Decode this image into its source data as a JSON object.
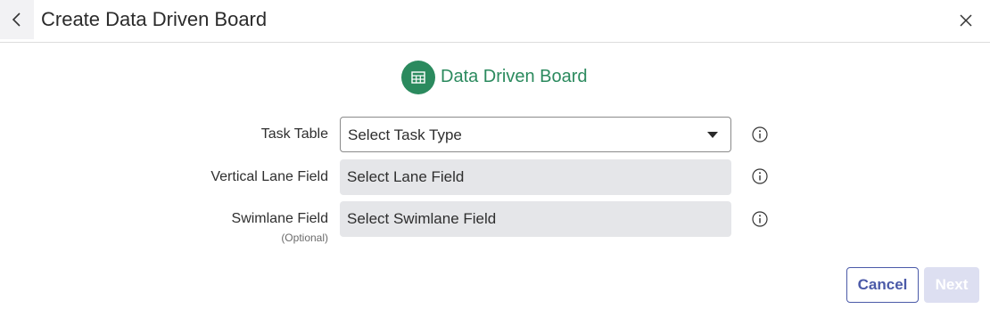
{
  "header": {
    "title": "Create Data Driven Board",
    "back_icon": "chevron-left-icon",
    "close_icon": "close-icon"
  },
  "board": {
    "icon": "table-grid-icon",
    "name": "Data Driven Board",
    "accent_color": "#2b8a5e"
  },
  "form": {
    "task_table": {
      "label": "Task Table",
      "placeholder": "Select Task Type"
    },
    "vertical_lane": {
      "label": "Vertical Lane Field",
      "placeholder": "Select Lane Field"
    },
    "swimlane": {
      "label": "Swimlane Field",
      "sub_label": "(Optional)",
      "placeholder": "Select Swimlane Field"
    },
    "info_icon": "info-circle-icon"
  },
  "footer": {
    "cancel_label": "Cancel",
    "next_label": "Next",
    "primary_color": "#4b5aa8"
  }
}
